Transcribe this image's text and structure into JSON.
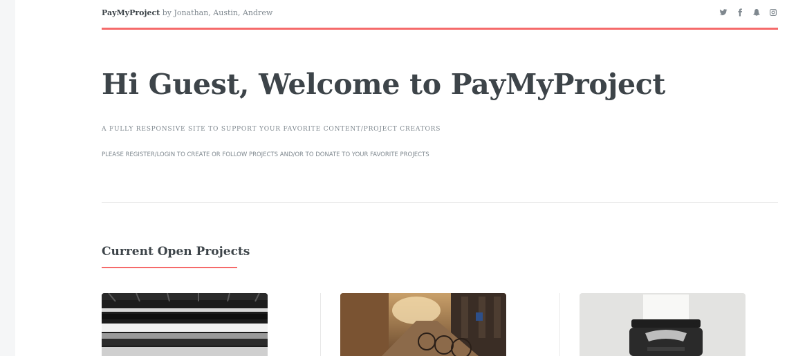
{
  "header": {
    "site_name": "PayMyProject",
    "byline": " by Jonathan, Austin, Andrew",
    "social_icons": [
      "twitter-icon",
      "facebook-icon",
      "snapchat-icon",
      "instagram-icon"
    ]
  },
  "hero": {
    "title": "Hi Guest, Welcome to PayMyProject",
    "tagline": "A FULLY RESPONSIVE SITE TO SUPPORT YOUR FAVORITE CONTENT/PROJECT CREATORS",
    "note": "PLEASE REGISTER/LOGIN TO CREATE OR FOLLOW PROJECTS AND/OR TO DONATE TO YOUR FAVORITE PROJECTS"
  },
  "projects": {
    "heading": "Current Open Projects",
    "cards": [
      {
        "image": "subway-train-photo"
      },
      {
        "image": "street-bicycles-photo"
      },
      {
        "image": "typewriter-photo"
      }
    ]
  },
  "colors": {
    "accent": "#f56a6a",
    "text": "#3d4449",
    "muted": "#7f888f"
  }
}
